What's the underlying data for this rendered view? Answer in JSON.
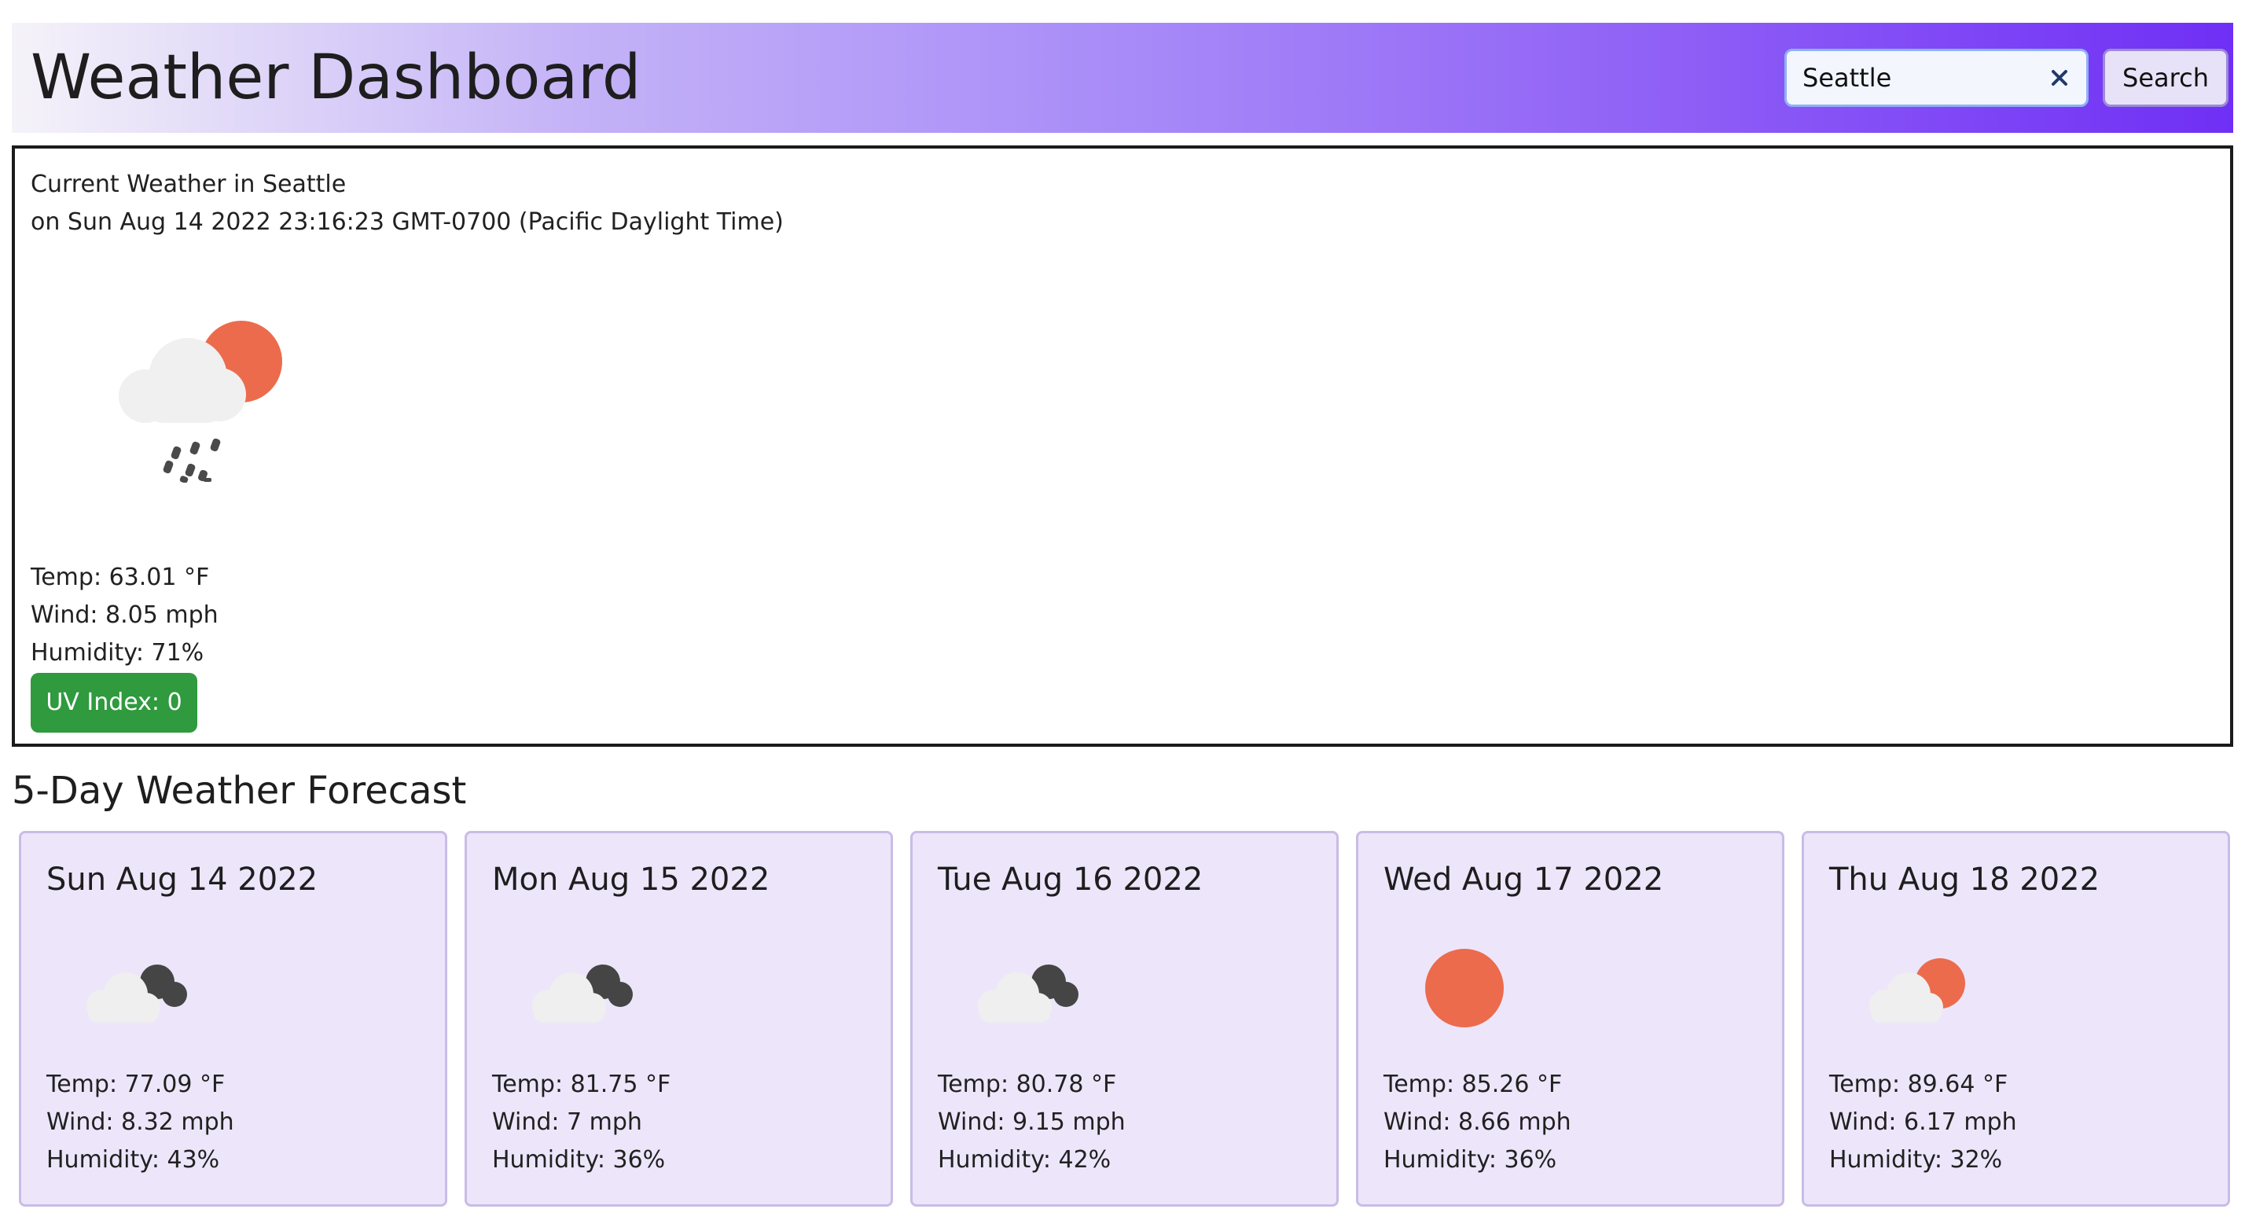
{
  "header": {
    "title": "Weather Dashboard",
    "search_value": "Seattle",
    "search_button": "Search"
  },
  "current": {
    "title": "Current Weather in Seattle",
    "date": "on Sun Aug 14 2022 23:16:23 GMT-0700 (Pacific Daylight Time)",
    "icon": "rain-sun-icon",
    "temp": "Temp: 63.01 °F",
    "wind": "Wind: 8.05 mph",
    "humidity": "Humidity: 71%",
    "uv": "UV Index: 0"
  },
  "forecast": {
    "title": "5-Day Weather Forecast",
    "days": [
      {
        "date": "Sun Aug 14 2022",
        "icon": "broken-clouds-icon",
        "temp": "Temp: 77.09 °F",
        "wind": "Wind: 8.32 mph",
        "humidity": "Humidity: 43%"
      },
      {
        "date": "Mon Aug 15 2022",
        "icon": "broken-clouds-icon",
        "temp": "Temp: 81.75 °F",
        "wind": "Wind: 7 mph",
        "humidity": "Humidity: 36%"
      },
      {
        "date": "Tue Aug 16 2022",
        "icon": "broken-clouds-icon",
        "temp": "Temp: 80.78 °F",
        "wind": "Wind: 9.15 mph",
        "humidity": "Humidity: 42%"
      },
      {
        "date": "Wed Aug 17 2022",
        "icon": "clear-sky-icon",
        "temp": "Temp: 85.26 °F",
        "wind": "Wind: 8.66 mph",
        "humidity": "Humidity: 36%"
      },
      {
        "date": "Thu Aug 18 2022",
        "icon": "few-clouds-icon",
        "temp": "Temp: 89.64 °F",
        "wind": "Wind: 6.17 mph",
        "humidity": "Humidity: 32%"
      }
    ]
  },
  "colors": {
    "uv_badge": "#2f9a3e",
    "card_bg": "#ede6fb",
    "sun": "#ec6b4d",
    "header_gradient_end": "#6f2ff5"
  }
}
